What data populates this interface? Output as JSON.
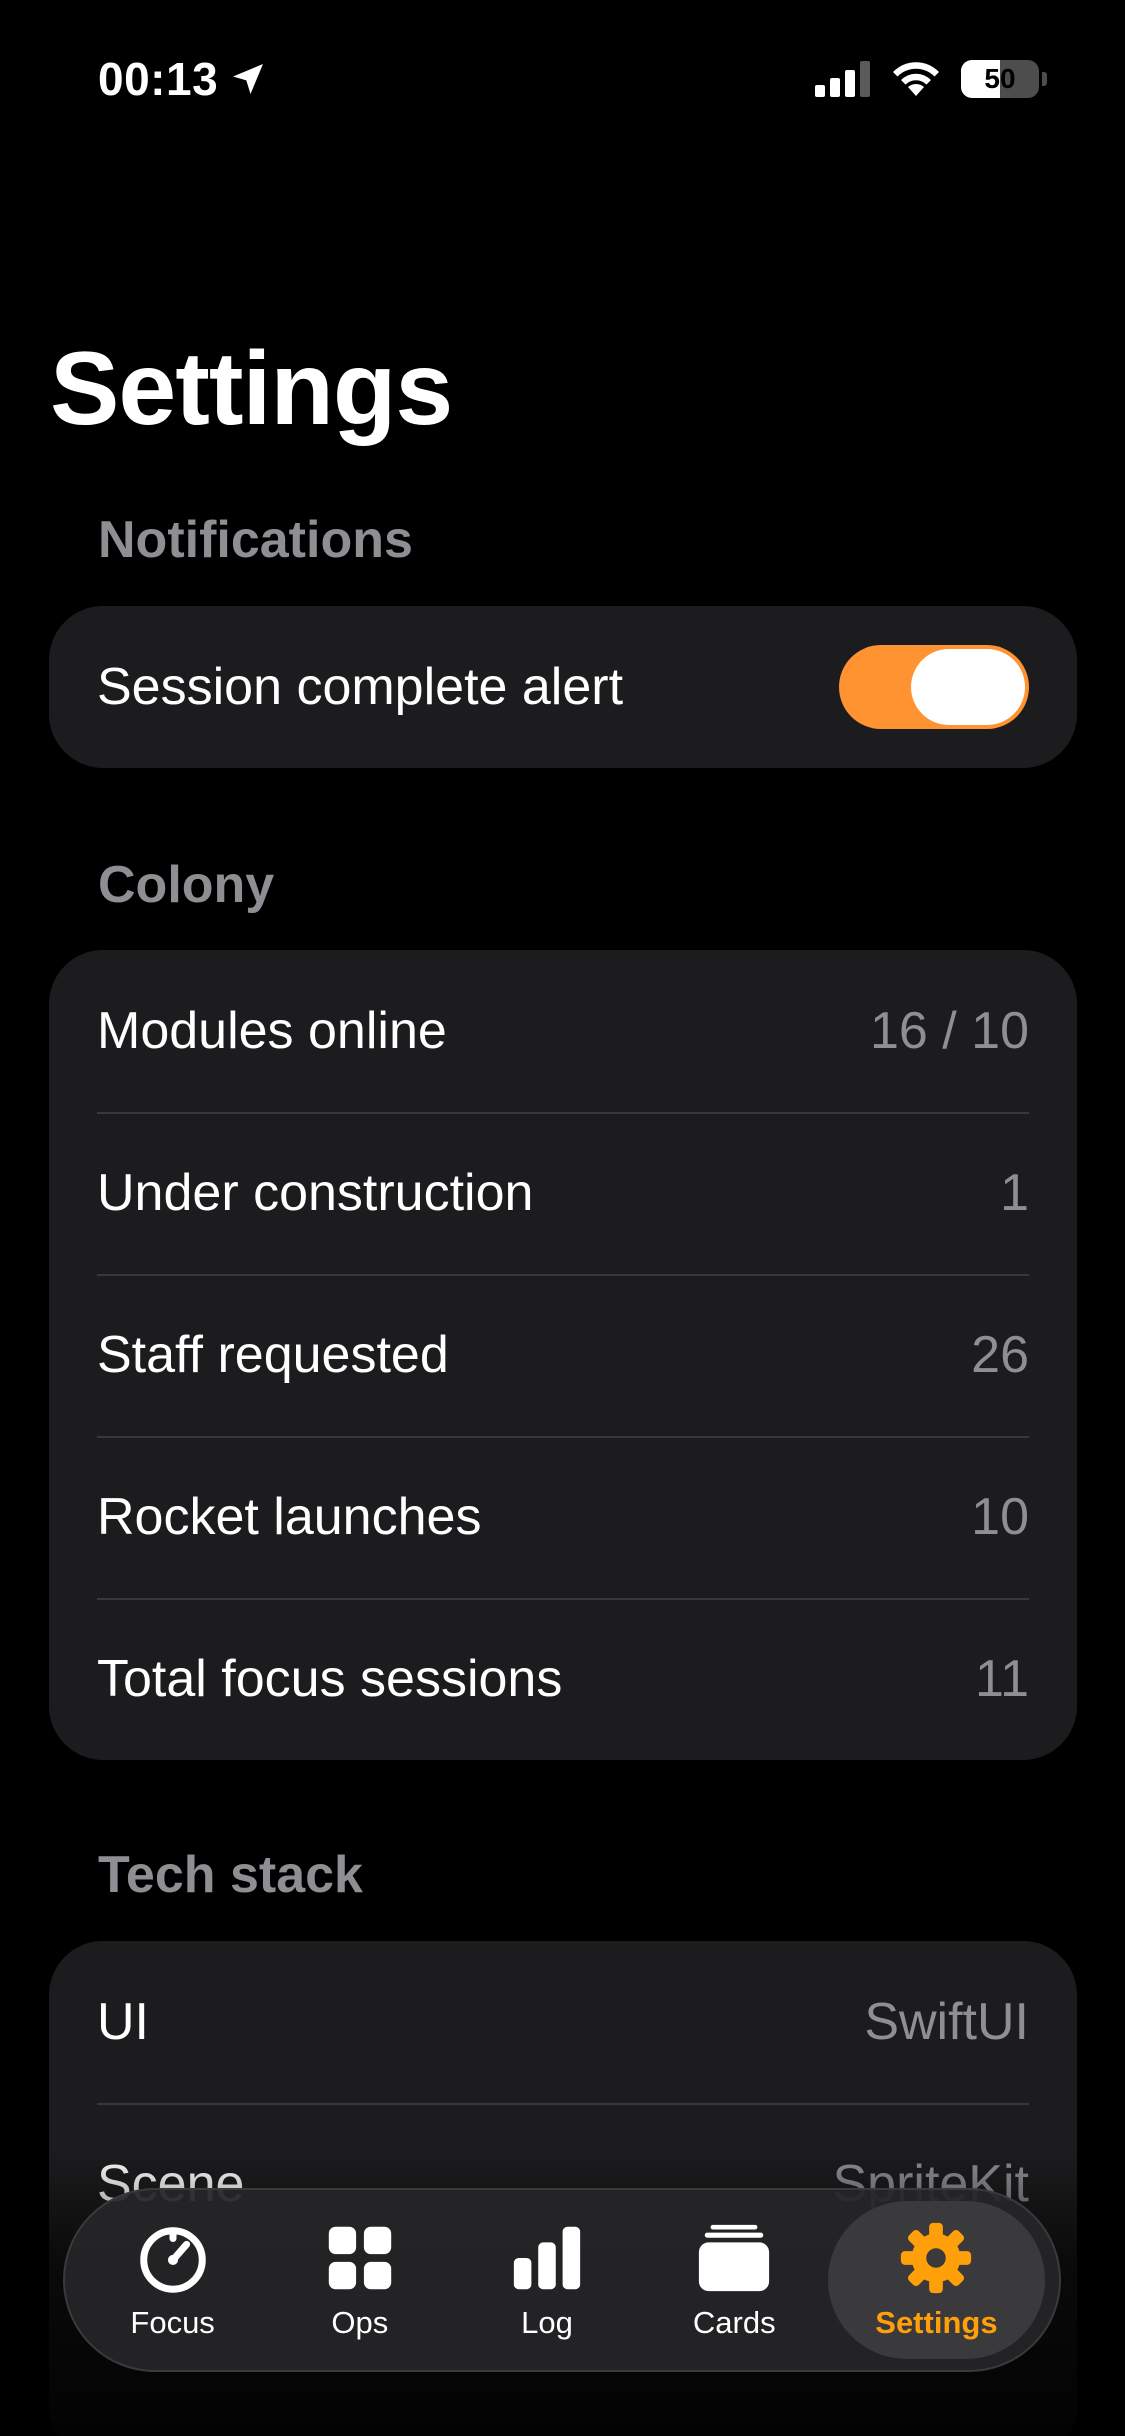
{
  "status_bar": {
    "time": "00:13",
    "battery_percent": "50",
    "battery_level": 0.5
  },
  "title": "Settings",
  "sections": {
    "notifications": {
      "header": "Notifications",
      "rows": [
        {
          "label": "Session complete alert",
          "toggle_on": true
        }
      ]
    },
    "colony": {
      "header": "Colony",
      "rows": [
        {
          "label": "Modules online",
          "value": "16 / 10"
        },
        {
          "label": "Under construction",
          "value": "1"
        },
        {
          "label": "Staff requested",
          "value": "26"
        },
        {
          "label": "Rocket launches",
          "value": "10"
        },
        {
          "label": "Total focus sessions",
          "value": "11"
        }
      ]
    },
    "tech_stack": {
      "header": "Tech stack",
      "rows": [
        {
          "label": "UI",
          "value": "SwiftUI"
        },
        {
          "label": "Scene",
          "value": "SpriteKit"
        }
      ]
    }
  },
  "tab_bar": {
    "tabs": [
      {
        "label": "Focus",
        "icon": "timer-icon"
      },
      {
        "label": "Ops",
        "icon": "grid-icon"
      },
      {
        "label": "Log",
        "icon": "bar-chart-icon"
      },
      {
        "label": "Cards",
        "icon": "cards-stack-icon"
      },
      {
        "label": "Settings",
        "icon": "gear-icon",
        "active": true
      }
    ]
  },
  "colors": {
    "accent": "#ff9231",
    "active_tab": "#ff9f0a",
    "background": "#000000",
    "card": "#1c1c1e",
    "secondary_text": "#8e8e93"
  }
}
